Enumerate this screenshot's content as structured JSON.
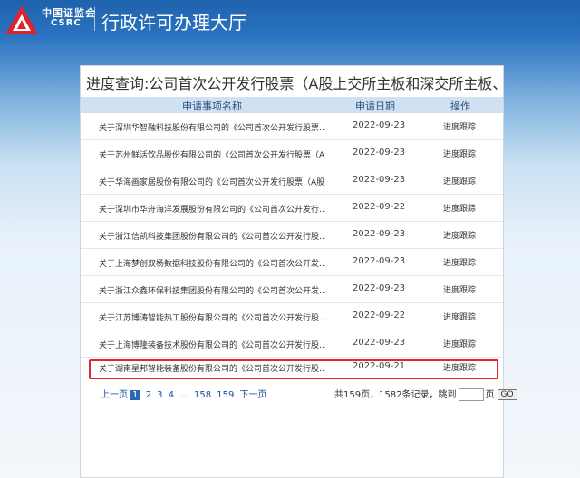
{
  "header": {
    "brand_cn": "中国证监会",
    "brand_en": "CSRC",
    "site_title": "行政许可办理大厅"
  },
  "page_title": "进度查询:公司首次公开发行股票（A股上交所主板和深交所主板、B...",
  "table": {
    "columns": [
      "申请事项名称",
      "申请日期",
      "操作"
    ],
    "rows": [
      {
        "name": "关于深圳华智融科技股份有限公司的《公司首次公开发行股票...",
        "date": "2022-09-23",
        "op": "进度跟踪"
      },
      {
        "name": "关于苏州鲜活饮品股份有限公司的《公司首次公开发行股票（A...",
        "date": "2022-09-23",
        "op": "进度跟踪"
      },
      {
        "name": "关于华海画家居股份有限公司的《公司首次公开发行股票（A股...",
        "date": "2022-09-23",
        "op": "进度跟踪"
      },
      {
        "name": "关于深圳市华舟海洋发展股份有限公司的《公司首次公开发行...",
        "date": "2022-09-22",
        "op": "进度跟踪"
      },
      {
        "name": "关于浙江信凯科技集团股份有限公司的《公司首次公开发行股...",
        "date": "2022-09-23",
        "op": "进度跟踪"
      },
      {
        "name": "关于上海梦创双杨数据科技股份有限公司的《公司首次公开发...",
        "date": "2022-09-23",
        "op": "进度跟踪"
      },
      {
        "name": "关于浙江众鑫环保科技集团股份有限公司的《公司首次公开发...",
        "date": "2022-09-23",
        "op": "进度跟踪"
      },
      {
        "name": "关于江苏博涛智能热工股份有限公司的《公司首次公开发行股...",
        "date": "2022-09-22",
        "op": "进度跟踪"
      },
      {
        "name": "关于上海博隆装备技术股份有限公司的《公司首次公开发行股...",
        "date": "2022-09-23",
        "op": "进度跟踪"
      },
      {
        "name": "关于湖南星邦智能装备股份有限公司的《公司首次公开发行股...",
        "date": "2022-09-21",
        "op": "进度跟踪"
      }
    ]
  },
  "pager": {
    "prev": "上一页",
    "current": "1",
    "pages": [
      "2",
      "3",
      "4"
    ],
    "ellipsis": "...",
    "tail_pages": [
      "158",
      "159"
    ],
    "next": "下一页",
    "summary": "共159页，1582条记录，跳到",
    "page_suffix": "页",
    "go": "GO"
  }
}
